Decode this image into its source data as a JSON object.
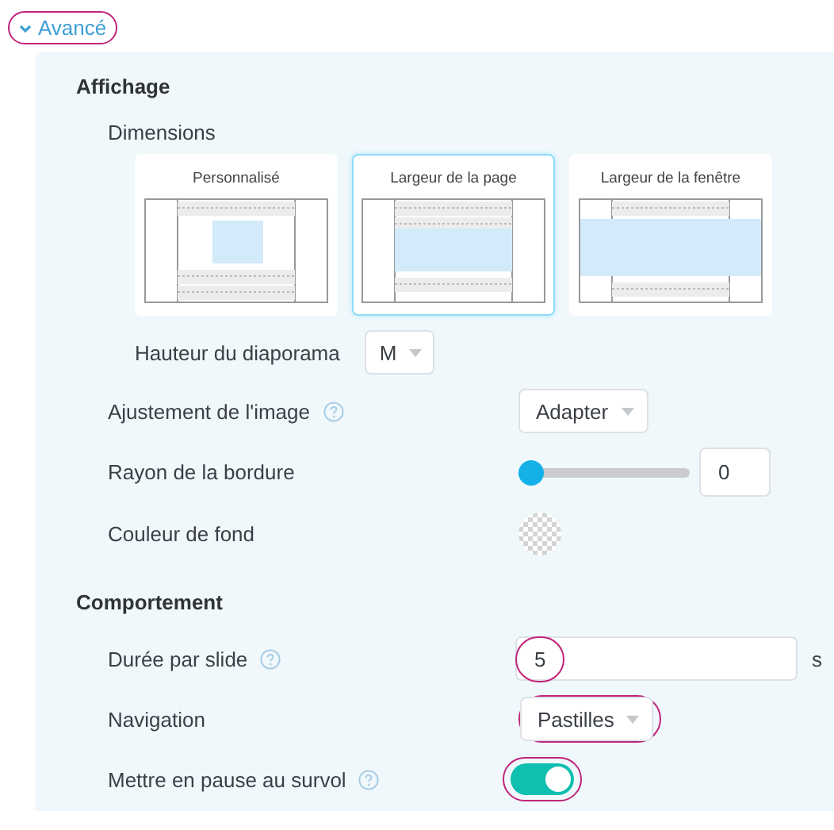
{
  "advanced_toggle": {
    "label": "Avancé",
    "expanded": true,
    "annotated": true
  },
  "sections": [
    {
      "title": "Affichage",
      "rows": [
        {
          "kind": "dimensions",
          "label": "Dimensions",
          "options": [
            {
              "label": "Personnalisé",
              "kind": "custom",
              "selected": false
            },
            {
              "label": "Largeur de la page",
              "kind": "page",
              "selected": true
            },
            {
              "label": "Largeur de la fenêtre",
              "kind": "window",
              "selected": false
            }
          ]
        },
        {
          "kind": "inline-select",
          "label": "Hauteur du diaporama",
          "value": "M"
        },
        {
          "kind": "select",
          "label": "Ajustement de l'image",
          "help": true,
          "value": "Adapter"
        },
        {
          "kind": "slider",
          "label": "Rayon de la bordure",
          "level": 0,
          "value": "0"
        },
        {
          "kind": "color",
          "label": "Couleur de fond"
        }
      ]
    },
    {
      "title": "Comportement",
      "rows": [
        {
          "kind": "number",
          "label": "Durée par slide",
          "help": true,
          "value": "5",
          "unit": "s",
          "annotated": true
        },
        {
          "kind": "select",
          "label": "Navigation",
          "value": "Pastilles",
          "annotated": true
        },
        {
          "kind": "toggle",
          "label": "Mettre en pause au survol",
          "help": true,
          "on": true,
          "annotated": true
        }
      ]
    }
  ]
}
